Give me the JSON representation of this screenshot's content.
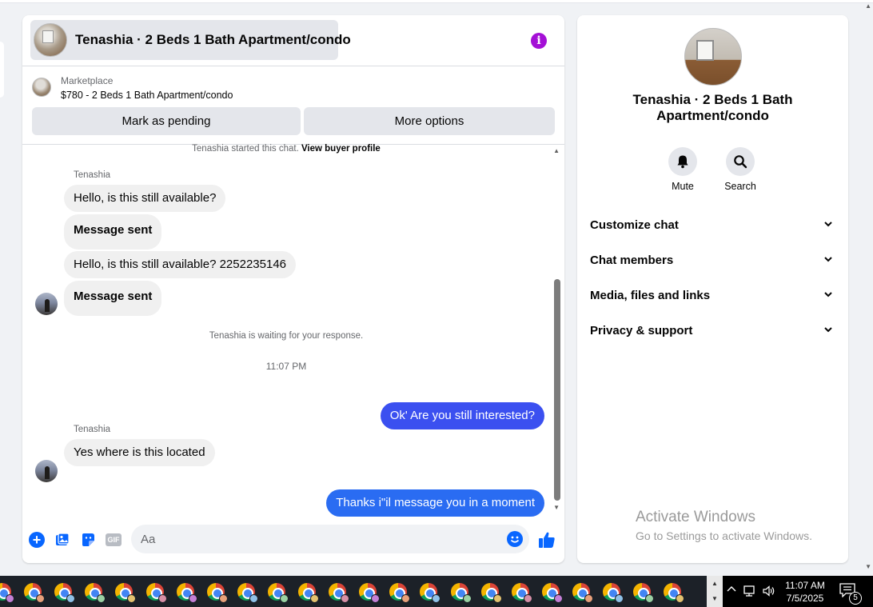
{
  "header": {
    "title": "Tenashia · 2 Beds 1 Bath Apartment/condo",
    "info_glyph": "i"
  },
  "marketplace": {
    "label": "Marketplace",
    "listing": "$780 - 2 Beds 1 Bath Apartment/condo",
    "pending_button": "Mark as pending",
    "more_button": "More options"
  },
  "messages": {
    "started": "Tenashia started this chat.",
    "view_profile": "View buyer profile",
    "sender_name": "Tenashia",
    "m1": "Hello, is this still available?",
    "m2": "Message sent",
    "m3": "Hello, is this still available? 2252235146",
    "m4": "Message sent",
    "waiting": "Tenashia is waiting for your response.",
    "time": "11:07 PM",
    "m5": "Ok' Are you still interested?",
    "sender_name_2": "Tenashia",
    "m6": "Yes where is this located",
    "m7": "Thanks i\"il message you in a moment"
  },
  "composer": {
    "placeholder": "Aa",
    "gif_label": "GIF"
  },
  "info_panel": {
    "title": "Tenashia · 2 Beds 1 Bath Apartment/condo",
    "mute_label": "Mute",
    "search_label": "Search",
    "sections": [
      "Customize chat",
      "Chat members",
      "Media, files and links",
      "Privacy & support"
    ],
    "watermark_title": "Activate Windows",
    "watermark_sub": "Go to Settings to activate Windows."
  },
  "taskbar": {
    "time": "11:07 AM",
    "date": "7/5/2025",
    "notification_count": "5",
    "chrome_profiles": 23
  },
  "colors": {
    "accent_blue": "#0866ff",
    "my_bubble": "#3b50f0",
    "info_purple": "#a40fd6",
    "panel_bg": "#f0f2f5"
  },
  "icons": [
    "info-icon",
    "plus-icon",
    "photo-icon",
    "sticker-icon",
    "gif-icon",
    "emoji-icon",
    "like-icon",
    "bell-icon",
    "search-icon",
    "chevron-down-icon",
    "chrome-icon",
    "network-icon",
    "volume-icon",
    "notification-icon"
  ]
}
